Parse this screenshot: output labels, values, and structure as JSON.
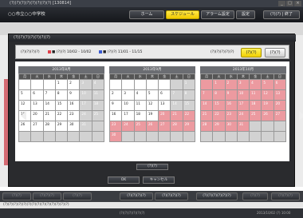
{
  "window": {
    "title": "(?)(?)(?)(?)(?)(?)(?)(?) [130814]",
    "ctrl_min": "_",
    "ctrl_max": "□",
    "ctrl_close": "×"
  },
  "app": {
    "school": "○○市立○○中学校",
    "nav": [
      "ホーム",
      "スケジュール",
      "アラーム設定",
      "設定"
    ],
    "active_nav_index": 1,
    "login": "(?)(?) | 終了"
  },
  "modal": {
    "title": "(?)(?)(?)(?)(?)(?)(?)"
  },
  "legend": {
    "label": "(?)(?)(?)(?)",
    "item1": "■ (?)(?) 10/02 - 10/02",
    "item2": "■ (?)(?) 11/01 - 11/15",
    "item1_color": "#e0404a",
    "item2_color": "#3a5ad0"
  },
  "option": {
    "label": "(?)(?)(?)(?)(?)",
    "btn1": "(?)(?)",
    "btn2": "(?)(?)"
  },
  "weekdays": [
    "月",
    "火",
    "水",
    "木",
    "金",
    "土",
    "日"
  ],
  "months": [
    {
      "label": "2013年8月",
      "cells": [
        [
          "",
          ""
        ],
        [
          "",
          ""
        ],
        [
          "",
          "w"
        ],
        [
          "1",
          "w"
        ],
        [
          "2",
          "w"
        ],
        [
          "3",
          "g"
        ],
        [
          "4",
          "g"
        ],
        [
          "5",
          "w"
        ],
        [
          "6",
          "w"
        ],
        [
          "7",
          "w"
        ],
        [
          "8",
          "w"
        ],
        [
          "9",
          "w"
        ],
        [
          "10",
          "g"
        ],
        [
          "11",
          "g"
        ],
        [
          "12",
          "w"
        ],
        [
          "13",
          "w"
        ],
        [
          "14",
          "w"
        ],
        [
          "15",
          "w"
        ],
        [
          "16",
          "w"
        ],
        [
          "17",
          "g"
        ],
        [
          "18",
          "g"
        ],
        [
          "19",
          "w"
        ],
        [
          "20",
          "w"
        ],
        [
          "21",
          "w"
        ],
        [
          "22",
          "w"
        ],
        [
          "23",
          "w"
        ],
        [
          "24",
          "g"
        ],
        [
          "25",
          "g"
        ],
        [
          "26",
          "w"
        ],
        [
          "27",
          "w"
        ],
        [
          "28",
          "w"
        ],
        [
          "29",
          "w"
        ],
        [
          "30",
          "w"
        ],
        [
          "31",
          "g"
        ],
        [
          "",
          "g"
        ],
        [
          "",
          "g"
        ],
        [
          "",
          "g"
        ],
        [
          "",
          "g"
        ],
        [
          "",
          "g"
        ],
        [
          "",
          "g"
        ],
        [
          "",
          "g"
        ],
        [
          "",
          "g"
        ]
      ]
    },
    {
      "label": "2013年9月",
      "cells": [
        [
          "",
          "w"
        ],
        [
          "",
          "w"
        ],
        [
          "",
          "w"
        ],
        [
          "",
          "w"
        ],
        [
          "",
          "w"
        ],
        [
          "",
          "g"
        ],
        [
          "1",
          "g"
        ],
        [
          "2",
          "w"
        ],
        [
          "3",
          "w"
        ],
        [
          "4",
          "w"
        ],
        [
          "5",
          "w"
        ],
        [
          "6",
          "w"
        ],
        [
          "7",
          "g"
        ],
        [
          "8",
          "g"
        ],
        [
          "9",
          "w"
        ],
        [
          "10",
          "w"
        ],
        [
          "11",
          "w"
        ],
        [
          "12",
          "w"
        ],
        [
          "13",
          "w"
        ],
        [
          "14",
          "g"
        ],
        [
          "15",
          "g"
        ],
        [
          "16",
          "w"
        ],
        [
          "17",
          "w"
        ],
        [
          "18",
          "w"
        ],
        [
          "19",
          "w"
        ],
        [
          "20",
          "p"
        ],
        [
          "21",
          "p"
        ],
        [
          "22",
          "p"
        ],
        [
          "23",
          "p"
        ],
        [
          "24",
          "p"
        ],
        [
          "25",
          "p"
        ],
        [
          "26",
          "p"
        ],
        [
          "27",
          "p"
        ],
        [
          "28",
          "p"
        ],
        [
          "29",
          "p"
        ],
        [
          "30",
          "p"
        ],
        [
          "",
          "g"
        ],
        [
          "",
          "g"
        ],
        [
          "",
          "g"
        ],
        [
          "",
          "g"
        ],
        [
          "",
          "g"
        ],
        [
          "",
          "g"
        ]
      ]
    },
    {
      "label": "2013年10月",
      "cells": [
        [
          "",
          "p"
        ],
        [
          "1",
          "p"
        ],
        [
          "2",
          "p"
        ],
        [
          "3",
          "p"
        ],
        [
          "4",
          "p"
        ],
        [
          "5",
          "p"
        ],
        [
          "6",
          "p"
        ],
        [
          "7",
          "p"
        ],
        [
          "8",
          "p"
        ],
        [
          "9",
          "p"
        ],
        [
          "10",
          "p"
        ],
        [
          "11",
          "p"
        ],
        [
          "12",
          "p"
        ],
        [
          "13",
          "p"
        ],
        [
          "14",
          "p"
        ],
        [
          "15",
          "p"
        ],
        [
          "16",
          "p"
        ],
        [
          "17",
          "p"
        ],
        [
          "18",
          "p"
        ],
        [
          "19",
          "p"
        ],
        [
          "20",
          "p"
        ],
        [
          "21",
          "p"
        ],
        [
          "22",
          "p"
        ],
        [
          "23",
          "p"
        ],
        [
          "24",
          "p"
        ],
        [
          "25",
          "p"
        ],
        [
          "26",
          "p"
        ],
        [
          "27",
          "p"
        ],
        [
          "28",
          "p"
        ],
        [
          "29",
          "p"
        ],
        [
          "30",
          "p"
        ],
        [
          "31",
          "p"
        ],
        [
          "",
          "g"
        ],
        [
          "",
          "g"
        ],
        [
          "",
          "g"
        ],
        [
          "",
          "g"
        ],
        [
          "",
          "g"
        ],
        [
          "",
          "g"
        ],
        [
          "",
          "g"
        ],
        [
          "",
          "g"
        ],
        [
          "",
          "g"
        ],
        [
          "",
          "g"
        ]
      ]
    }
  ],
  "buttons": {
    "set": "(?)(?)",
    "ok": "OK",
    "cancel": "キャンセル"
  },
  "bottom": {
    "b1": "(?)(?)",
    "b2": "(?)(?)(?)",
    "b3": "(?)(?)",
    "b4": "(?)(?)(?)(?)",
    "b5": "(?)(?)(?)(?)",
    "b6": "(?)(?)(?)(?)(?)(?)",
    "b7": "(?)(?)",
    "b8": "(?)(?)(?)"
  },
  "status": "(?)(?)(?)(?)(?)(?)(?)(?)(?)(?)(?)(?)(?)(?)",
  "footer": {
    "center": "(?)(?)(?)(?)(?)(?)",
    "right": "2013/10/02 (?) 10:00"
  }
}
